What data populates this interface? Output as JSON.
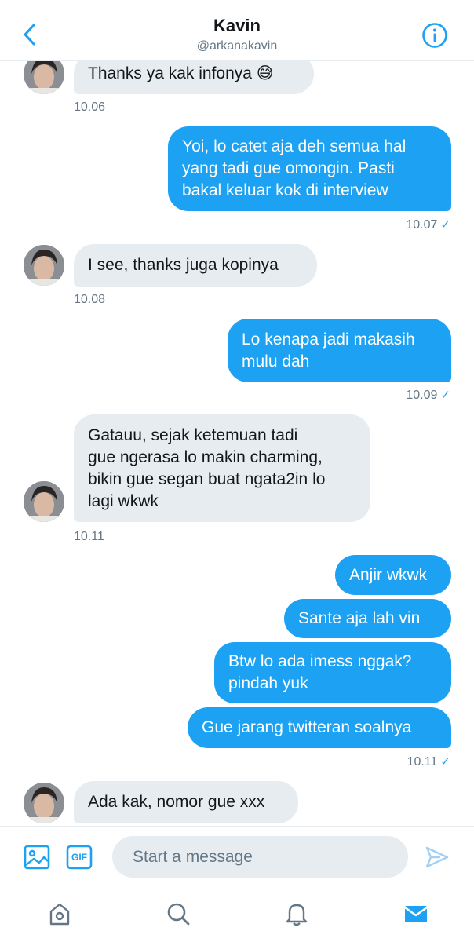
{
  "header": {
    "title": "Kavin",
    "handle": "@arkanakavin"
  },
  "messages": [
    {
      "sender": "them",
      "text": "Thanks ya kak infonya 😅",
      "time": "10.06"
    },
    {
      "sender": "me",
      "text": "Yoi, lo catet aja deh semua hal\nyang tadi gue omongin. Pasti\nbakal keluar kok di interview",
      "time": "10.07"
    },
    {
      "sender": "them",
      "text": "I see, thanks juga kopinya",
      "time": "10.08"
    },
    {
      "sender": "me",
      "text": "Lo kenapa jadi makasih\nmulu dah",
      "time": "10.09"
    },
    {
      "sender": "them",
      "text": "Gatauu, sejak ketemuan tadi\ngue ngerasa lo makin charming,\nbikin gue segan buat ngata2in lo\nlagi wkwk",
      "time": "10.11"
    },
    {
      "sender": "me",
      "text": "Anjir wkwk"
    },
    {
      "sender": "me",
      "text": "Sante aja lah vin"
    },
    {
      "sender": "me",
      "text": "Btw lo ada imess nggak?\npindah yuk"
    },
    {
      "sender": "me",
      "text": "Gue jarang twitteran soalnya",
      "time": "10.11"
    },
    {
      "sender": "them",
      "text": "Ada kak, nomor gue xxx"
    }
  ],
  "composer": {
    "placeholder": "Start a message",
    "gif_label": "GIF"
  },
  "colors": {
    "accent": "#1da1f2",
    "incoming_bubble": "#e6ecf0",
    "muted_text": "#657786"
  },
  "icons": {
    "back": "chevron-left-icon",
    "info": "info-icon",
    "image": "image-icon",
    "gif": "gif-icon",
    "send": "send-icon",
    "home": "home-icon",
    "search": "search-icon",
    "notifications": "bell-icon",
    "messages": "mail-icon"
  }
}
